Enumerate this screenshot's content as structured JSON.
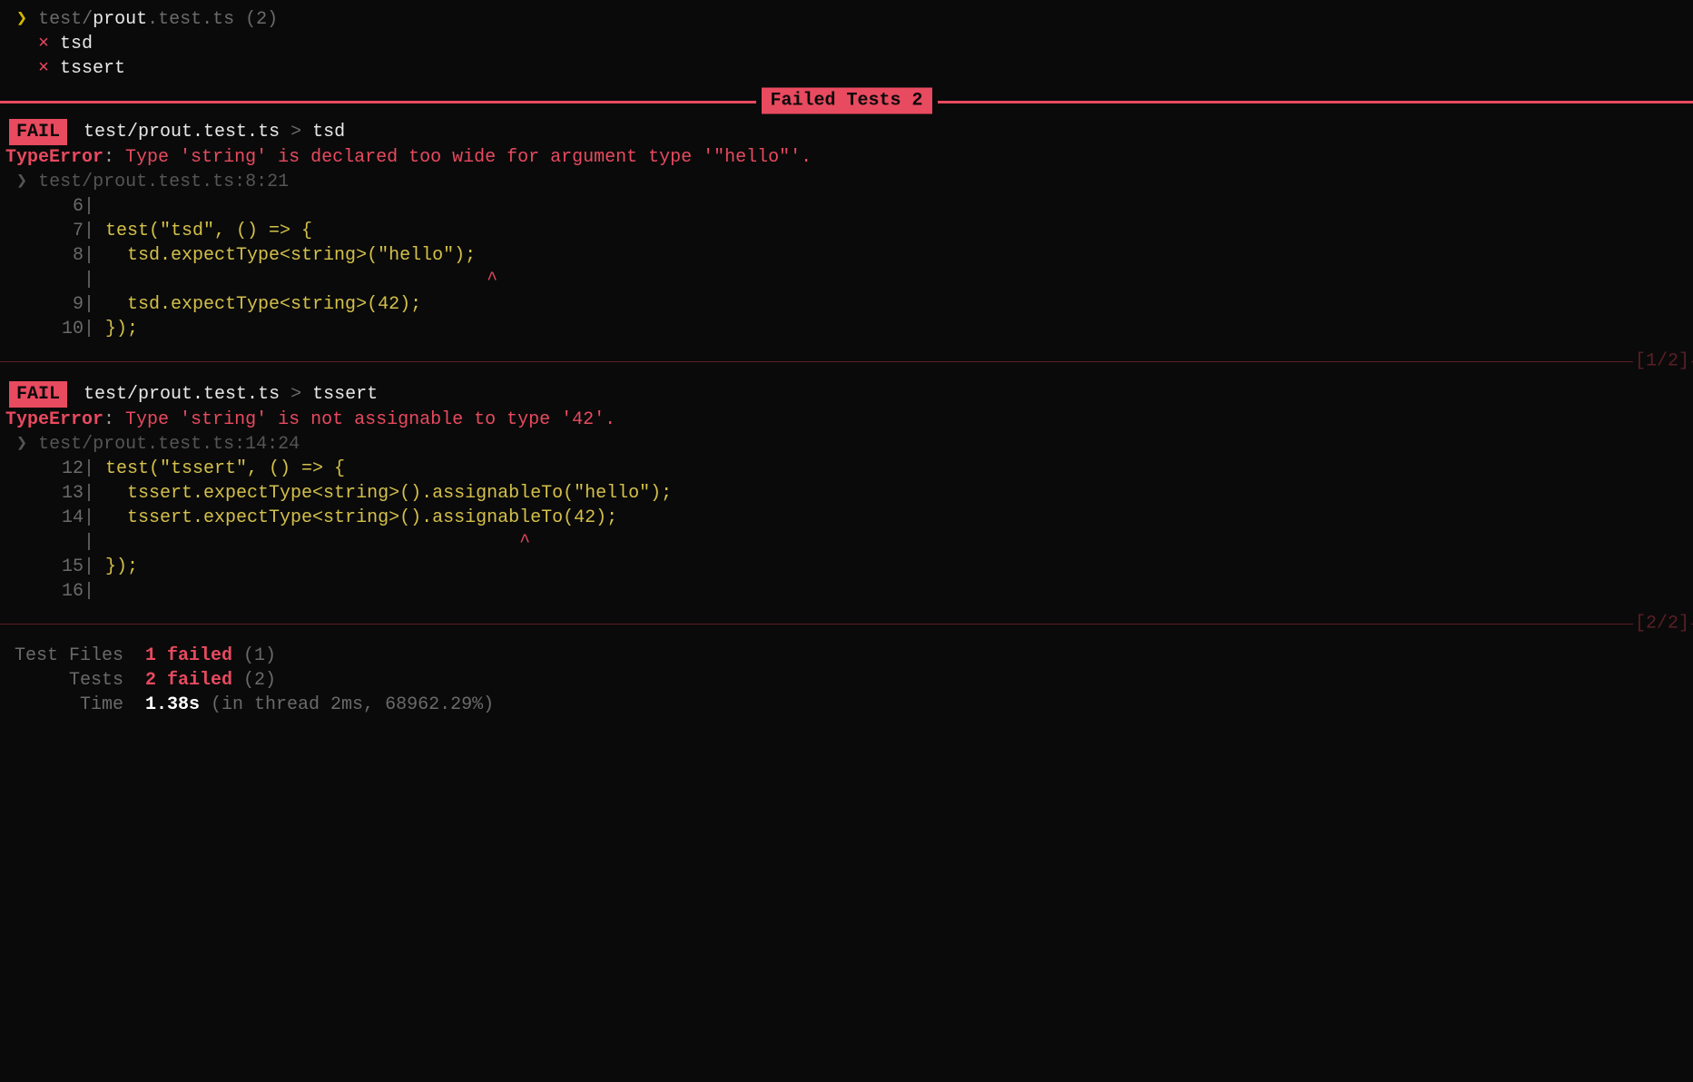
{
  "header": {
    "chevron": "❯",
    "path_pre": "test/",
    "path_bold": "prout",
    "path_post": ".test.ts",
    "count": "(2)"
  },
  "tests": [
    {
      "mark": "×",
      "name": "tsd"
    },
    {
      "mark": "×",
      "name": "tssert"
    }
  ],
  "banner": {
    "label": "Failed Tests 2"
  },
  "failures": [
    {
      "badge": "FAIL",
      "file": "test/prout.test.ts",
      "sep": ">",
      "test": "tsd",
      "error_type": "TypeError",
      "error_colon": ": ",
      "error_msg": "Type 'string' is declared too wide for argument type '\"hello\"'.",
      "loc_chevron": "❯",
      "location": "test/prout.test.ts:8:21",
      "code": [
        {
          "num": "6",
          "text": ""
        },
        {
          "num": "7",
          "text": " test(\"tsd\", () => {"
        },
        {
          "num": "8",
          "text": "   tsd.expectType<string>(\"hello\");"
        },
        {
          "num": "",
          "text": "                                    ",
          "caret": "^"
        },
        {
          "num": "9",
          "text": "   tsd.expectType<string>(42);"
        },
        {
          "num": "10",
          "text": " });"
        }
      ],
      "counter": "[1/2]"
    },
    {
      "badge": "FAIL",
      "file": "test/prout.test.ts",
      "sep": ">",
      "test": "tssert",
      "error_type": "TypeError",
      "error_colon": ": ",
      "error_msg": "Type 'string' is not assignable to type '42'.",
      "loc_chevron": "❯",
      "location": "test/prout.test.ts:14:24",
      "code": [
        {
          "num": "12",
          "text": " test(\"tssert\", () => {"
        },
        {
          "num": "13",
          "text": "   tssert.expectType<string>().assignableTo(\"hello\");"
        },
        {
          "num": "14",
          "text": "   tssert.expectType<string>().assignableTo(42);"
        },
        {
          "num": "",
          "text": "                                       ",
          "caret": "^"
        },
        {
          "num": "15",
          "text": " });"
        },
        {
          "num": "16",
          "text": ""
        }
      ],
      "counter": "[2/2]"
    }
  ],
  "summary": {
    "rows": [
      {
        "label": "Test Files",
        "value_red": "1 failed",
        "value_dim": " (1)"
      },
      {
        "label": "Tests",
        "value_red": "2 failed",
        "value_dim": " (2)"
      },
      {
        "label": "Time",
        "value_white": "1.38s",
        "value_dim": " (in thread 2ms, 68962.29%)"
      }
    ]
  }
}
